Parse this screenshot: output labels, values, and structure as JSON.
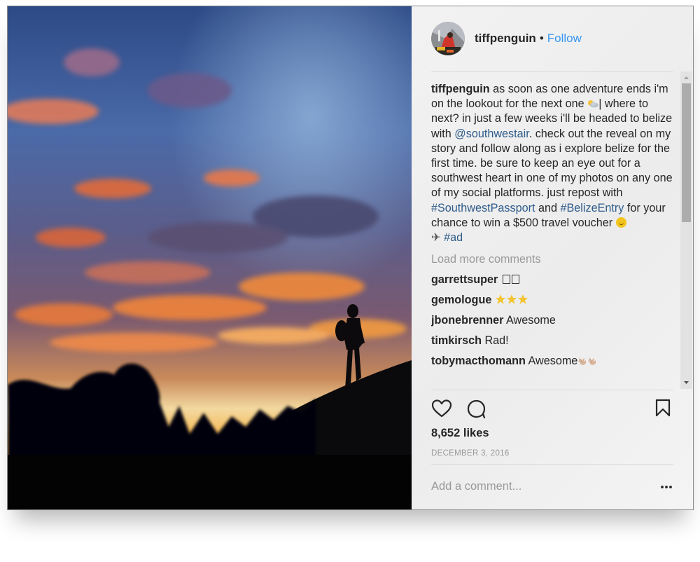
{
  "post": {
    "author": "tiffpenguin",
    "separator": "•",
    "follow_label": "Follow",
    "caption": {
      "username": "tiffpenguin",
      "part1": " as soon as one adventure ends i'm on the lookout for the next one ",
      "cloud_emoji": "sun-behind-cloud",
      "part2": "| where to next? in just a few weeks i'll be headed to belize with ",
      "mention": "@southwestair",
      "part3": ". check out the reveal on my story and follow along as i explore belize for the first time. be sure to keep an eye out for a southwest heart in one of my photos on any one of my social platforms. just repost with ",
      "hashtag1": "#SouthwestPassport",
      "part4": " and ",
      "hashtag2": "#BelizeEntry",
      "part5": " for your chance to win a $500 travel voucher ",
      "smile_emoji": "smiling-face",
      "plane": "✈",
      "hashtag3": "#ad"
    },
    "load_more_label": "Load more comments",
    "comments": [
      {
        "username": "garrettsuper",
        "text": "",
        "emoji": "two-unrendered-glyphs"
      },
      {
        "username": "gemologue",
        "text": "",
        "emoji": "three-glowing-stars"
      },
      {
        "username": "jbonebrenner",
        "text": "Awesome"
      },
      {
        "username": "timkirsch",
        "text": "Rad!"
      },
      {
        "username": "tobymacthomann",
        "text": "Awesome",
        "emoji": "two-ok-hands"
      }
    ],
    "likes": "8,652 likes",
    "date": "DECEMBER 3, 2016",
    "add_comment_placeholder": "Add a comment...",
    "colors": {
      "link": "#3897f0",
      "hashtag": "#2e5b8a",
      "muted": "#999999",
      "text": "#262626"
    }
  }
}
